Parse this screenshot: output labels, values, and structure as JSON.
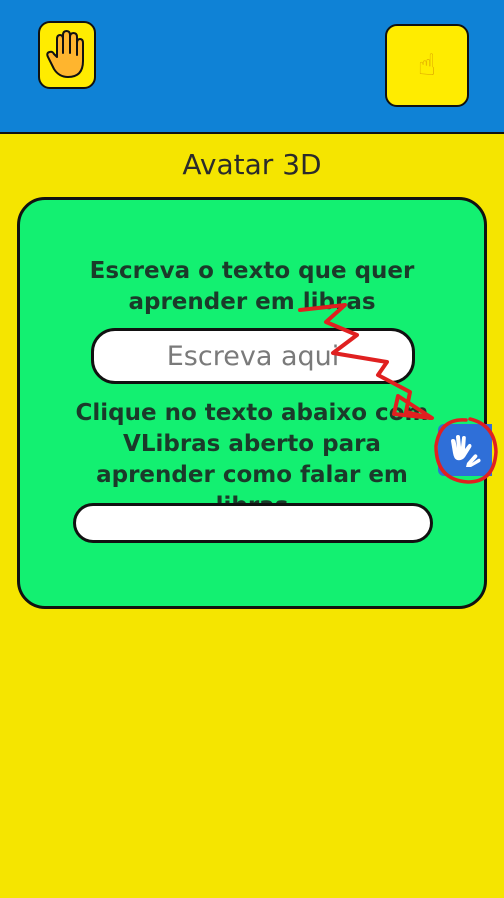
{
  "header": {
    "left_button_icon": "raised-hand-icon",
    "right_button_icon": "pointing-finger-icon",
    "right_button_glyph": "☝"
  },
  "page": {
    "title": "Avatar 3D"
  },
  "card": {
    "prompt": "Escreva o texto que quer aprender em libras",
    "input_placeholder": "Escreva aqui",
    "instruction": "Clique no texto abaixo com VLibras aberto para aprender como falar em libras",
    "output_value": ""
  },
  "vlibras": {
    "icon": "sign-language-hands-icon"
  },
  "colors": {
    "header": "#0f82d6",
    "background": "#f5e500",
    "card": "#13f071",
    "button": "#ffec00",
    "vlibras": "#2f6fd8",
    "annotation": "#e02020"
  }
}
